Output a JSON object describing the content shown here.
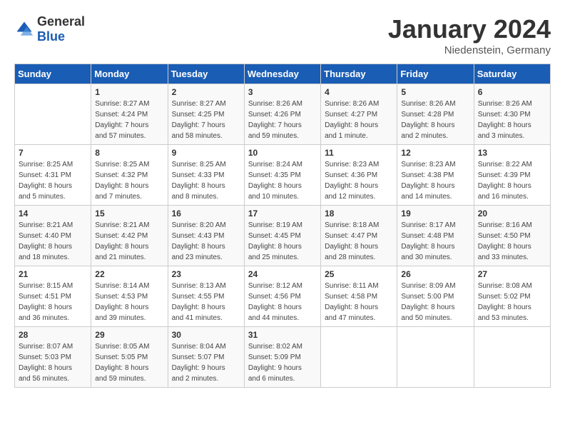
{
  "header": {
    "logo": {
      "general": "General",
      "blue": "Blue"
    },
    "title": "January 2024",
    "location": "Niedenstein, Germany"
  },
  "days_of_week": [
    "Sunday",
    "Monday",
    "Tuesday",
    "Wednesday",
    "Thursday",
    "Friday",
    "Saturday"
  ],
  "weeks": [
    [
      {
        "day": "",
        "info": ""
      },
      {
        "day": "1",
        "info": "Sunrise: 8:27 AM\nSunset: 4:24 PM\nDaylight: 7 hours\nand 57 minutes."
      },
      {
        "day": "2",
        "info": "Sunrise: 8:27 AM\nSunset: 4:25 PM\nDaylight: 7 hours\nand 58 minutes."
      },
      {
        "day": "3",
        "info": "Sunrise: 8:26 AM\nSunset: 4:26 PM\nDaylight: 7 hours\nand 59 minutes."
      },
      {
        "day": "4",
        "info": "Sunrise: 8:26 AM\nSunset: 4:27 PM\nDaylight: 8 hours\nand 1 minute."
      },
      {
        "day": "5",
        "info": "Sunrise: 8:26 AM\nSunset: 4:28 PM\nDaylight: 8 hours\nand 2 minutes."
      },
      {
        "day": "6",
        "info": "Sunrise: 8:26 AM\nSunset: 4:30 PM\nDaylight: 8 hours\nand 3 minutes."
      }
    ],
    [
      {
        "day": "7",
        "info": "Sunrise: 8:25 AM\nSunset: 4:31 PM\nDaylight: 8 hours\nand 5 minutes."
      },
      {
        "day": "8",
        "info": "Sunrise: 8:25 AM\nSunset: 4:32 PM\nDaylight: 8 hours\nand 7 minutes."
      },
      {
        "day": "9",
        "info": "Sunrise: 8:25 AM\nSunset: 4:33 PM\nDaylight: 8 hours\nand 8 minutes."
      },
      {
        "day": "10",
        "info": "Sunrise: 8:24 AM\nSunset: 4:35 PM\nDaylight: 8 hours\nand 10 minutes."
      },
      {
        "day": "11",
        "info": "Sunrise: 8:23 AM\nSunset: 4:36 PM\nDaylight: 8 hours\nand 12 minutes."
      },
      {
        "day": "12",
        "info": "Sunrise: 8:23 AM\nSunset: 4:38 PM\nDaylight: 8 hours\nand 14 minutes."
      },
      {
        "day": "13",
        "info": "Sunrise: 8:22 AM\nSunset: 4:39 PM\nDaylight: 8 hours\nand 16 minutes."
      }
    ],
    [
      {
        "day": "14",
        "info": "Sunrise: 8:21 AM\nSunset: 4:40 PM\nDaylight: 8 hours\nand 18 minutes."
      },
      {
        "day": "15",
        "info": "Sunrise: 8:21 AM\nSunset: 4:42 PM\nDaylight: 8 hours\nand 21 minutes."
      },
      {
        "day": "16",
        "info": "Sunrise: 8:20 AM\nSunset: 4:43 PM\nDaylight: 8 hours\nand 23 minutes."
      },
      {
        "day": "17",
        "info": "Sunrise: 8:19 AM\nSunset: 4:45 PM\nDaylight: 8 hours\nand 25 minutes."
      },
      {
        "day": "18",
        "info": "Sunrise: 8:18 AM\nSunset: 4:47 PM\nDaylight: 8 hours\nand 28 minutes."
      },
      {
        "day": "19",
        "info": "Sunrise: 8:17 AM\nSunset: 4:48 PM\nDaylight: 8 hours\nand 30 minutes."
      },
      {
        "day": "20",
        "info": "Sunrise: 8:16 AM\nSunset: 4:50 PM\nDaylight: 8 hours\nand 33 minutes."
      }
    ],
    [
      {
        "day": "21",
        "info": "Sunrise: 8:15 AM\nSunset: 4:51 PM\nDaylight: 8 hours\nand 36 minutes."
      },
      {
        "day": "22",
        "info": "Sunrise: 8:14 AM\nSunset: 4:53 PM\nDaylight: 8 hours\nand 39 minutes."
      },
      {
        "day": "23",
        "info": "Sunrise: 8:13 AM\nSunset: 4:55 PM\nDaylight: 8 hours\nand 41 minutes."
      },
      {
        "day": "24",
        "info": "Sunrise: 8:12 AM\nSunset: 4:56 PM\nDaylight: 8 hours\nand 44 minutes."
      },
      {
        "day": "25",
        "info": "Sunrise: 8:11 AM\nSunset: 4:58 PM\nDaylight: 8 hours\nand 47 minutes."
      },
      {
        "day": "26",
        "info": "Sunrise: 8:09 AM\nSunset: 5:00 PM\nDaylight: 8 hours\nand 50 minutes."
      },
      {
        "day": "27",
        "info": "Sunrise: 8:08 AM\nSunset: 5:02 PM\nDaylight: 8 hours\nand 53 minutes."
      }
    ],
    [
      {
        "day": "28",
        "info": "Sunrise: 8:07 AM\nSunset: 5:03 PM\nDaylight: 8 hours\nand 56 minutes."
      },
      {
        "day": "29",
        "info": "Sunrise: 8:05 AM\nSunset: 5:05 PM\nDaylight: 8 hours\nand 59 minutes."
      },
      {
        "day": "30",
        "info": "Sunrise: 8:04 AM\nSunset: 5:07 PM\nDaylight: 9 hours\nand 2 minutes."
      },
      {
        "day": "31",
        "info": "Sunrise: 8:02 AM\nSunset: 5:09 PM\nDaylight: 9 hours\nand 6 minutes."
      },
      {
        "day": "",
        "info": ""
      },
      {
        "day": "",
        "info": ""
      },
      {
        "day": "",
        "info": ""
      }
    ]
  ]
}
